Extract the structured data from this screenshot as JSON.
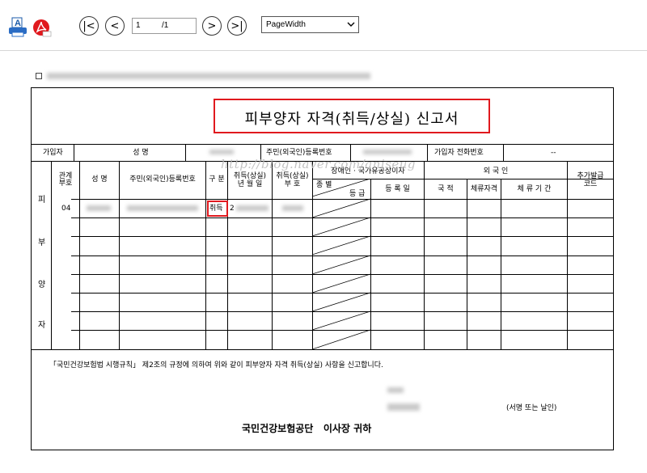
{
  "toolbar": {
    "first_page_glyph": "|<",
    "prev_page_glyph": "<",
    "current_page": "1",
    "total_pages": "/1",
    "next_page_glyph": ">",
    "last_page_glyph": ">|",
    "zoom_value": "PageWidth",
    "icons": [
      "print-icon",
      "pdf-icon",
      "chevron-down-icon"
    ]
  },
  "document": {
    "title": "피부양자 자격(취득/상실) 신고서",
    "header_row": {
      "subscriber_label": "가입자",
      "name_label": "성 명",
      "rrn_label": "주민(외국인)등록번호",
      "phone_label": "가입자 전화번호",
      "phone_value": "--"
    },
    "columns": {
      "relation_code_1": "관계",
      "relation_code_2": "부호",
      "name": "성 명",
      "rrn": "주민(외국인)등록번호",
      "type": "구 분",
      "date_1": "취득(상실)",
      "date_2": "년 월 일",
      "code_1": "취득(상실)",
      "code_2": "부 호",
      "disabled_top": "장애인 · 국가유공상이자",
      "disabled_kind": "종 별",
      "disabled_grade": "등 급",
      "reg_date": "등 록 일",
      "foreigner": "외 국 인",
      "nationality": "국 적",
      "stay_status": "체류자격",
      "stay_period": "체 류 기 간",
      "extra_code_1": "추가발급",
      "extra_code_2": "코드"
    },
    "side_labels": [
      "피",
      "부",
      "양",
      "자"
    ],
    "rows": [
      {
        "relation_code": "04",
        "type": "취득",
        "date_prefix": "2"
      }
    ],
    "watermark": "http://blog.naver.com/aniseug",
    "declaration": "「국민건강보험법 시행규칙」 제2조의 규정에 의하여 위와 같이 피부양자 자격 취득(상실) 사항을 신고합니다.",
    "sign_note": "(서명 또는 날인)",
    "addressee": "국민건강보험공단   이사장 귀하"
  },
  "colors": {
    "highlight": "#e0191e",
    "border": "#000000"
  }
}
